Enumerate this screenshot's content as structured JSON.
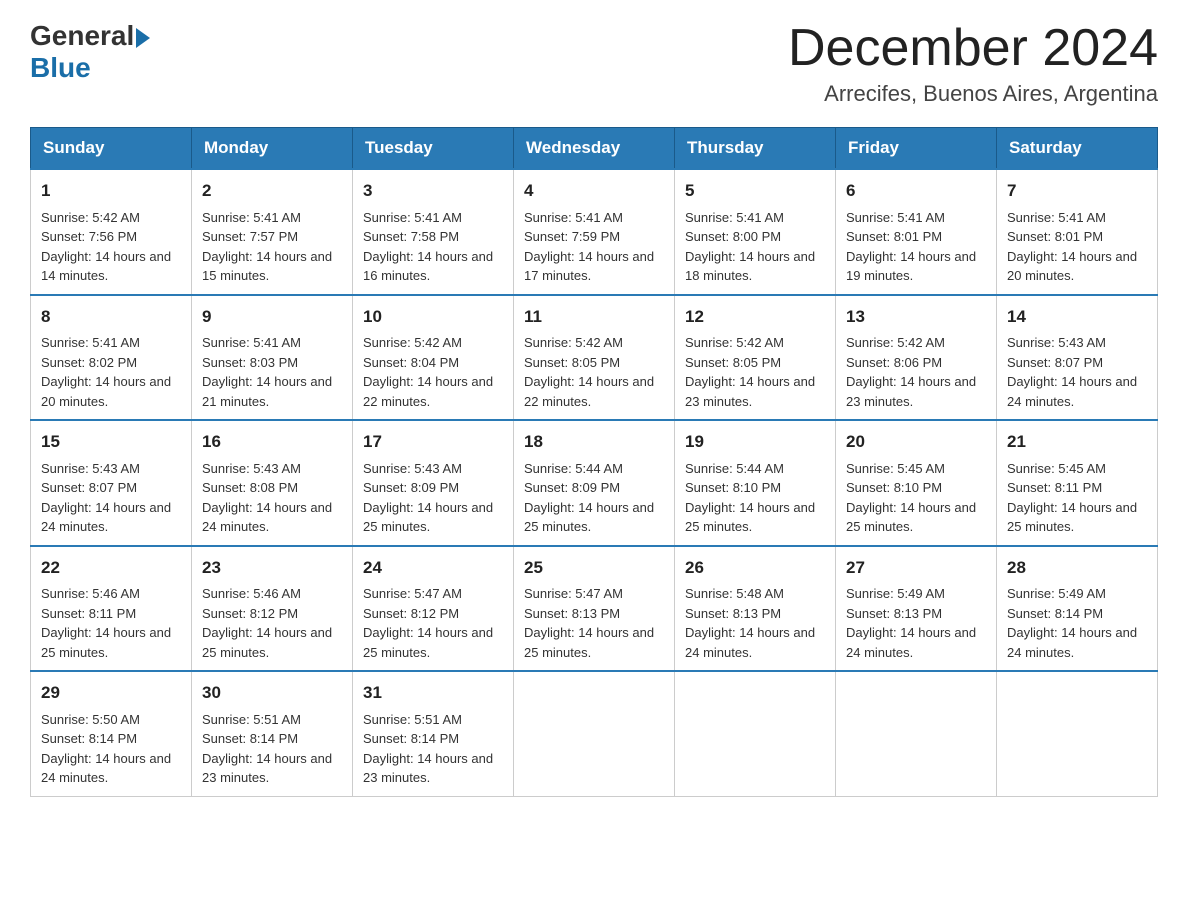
{
  "header": {
    "logo_general": "General",
    "logo_blue": "Blue",
    "month_title": "December 2024",
    "location": "Arrecifes, Buenos Aires, Argentina"
  },
  "days_of_week": [
    "Sunday",
    "Monday",
    "Tuesday",
    "Wednesday",
    "Thursday",
    "Friday",
    "Saturday"
  ],
  "weeks": [
    [
      {
        "day": "1",
        "sunrise": "Sunrise: 5:42 AM",
        "sunset": "Sunset: 7:56 PM",
        "daylight": "Daylight: 14 hours and 14 minutes."
      },
      {
        "day": "2",
        "sunrise": "Sunrise: 5:41 AM",
        "sunset": "Sunset: 7:57 PM",
        "daylight": "Daylight: 14 hours and 15 minutes."
      },
      {
        "day": "3",
        "sunrise": "Sunrise: 5:41 AM",
        "sunset": "Sunset: 7:58 PM",
        "daylight": "Daylight: 14 hours and 16 minutes."
      },
      {
        "day": "4",
        "sunrise": "Sunrise: 5:41 AM",
        "sunset": "Sunset: 7:59 PM",
        "daylight": "Daylight: 14 hours and 17 minutes."
      },
      {
        "day": "5",
        "sunrise": "Sunrise: 5:41 AM",
        "sunset": "Sunset: 8:00 PM",
        "daylight": "Daylight: 14 hours and 18 minutes."
      },
      {
        "day": "6",
        "sunrise": "Sunrise: 5:41 AM",
        "sunset": "Sunset: 8:01 PM",
        "daylight": "Daylight: 14 hours and 19 minutes."
      },
      {
        "day": "7",
        "sunrise": "Sunrise: 5:41 AM",
        "sunset": "Sunset: 8:01 PM",
        "daylight": "Daylight: 14 hours and 20 minutes."
      }
    ],
    [
      {
        "day": "8",
        "sunrise": "Sunrise: 5:41 AM",
        "sunset": "Sunset: 8:02 PM",
        "daylight": "Daylight: 14 hours and 20 minutes."
      },
      {
        "day": "9",
        "sunrise": "Sunrise: 5:41 AM",
        "sunset": "Sunset: 8:03 PM",
        "daylight": "Daylight: 14 hours and 21 minutes."
      },
      {
        "day": "10",
        "sunrise": "Sunrise: 5:42 AM",
        "sunset": "Sunset: 8:04 PM",
        "daylight": "Daylight: 14 hours and 22 minutes."
      },
      {
        "day": "11",
        "sunrise": "Sunrise: 5:42 AM",
        "sunset": "Sunset: 8:05 PM",
        "daylight": "Daylight: 14 hours and 22 minutes."
      },
      {
        "day": "12",
        "sunrise": "Sunrise: 5:42 AM",
        "sunset": "Sunset: 8:05 PM",
        "daylight": "Daylight: 14 hours and 23 minutes."
      },
      {
        "day": "13",
        "sunrise": "Sunrise: 5:42 AM",
        "sunset": "Sunset: 8:06 PM",
        "daylight": "Daylight: 14 hours and 23 minutes."
      },
      {
        "day": "14",
        "sunrise": "Sunrise: 5:43 AM",
        "sunset": "Sunset: 8:07 PM",
        "daylight": "Daylight: 14 hours and 24 minutes."
      }
    ],
    [
      {
        "day": "15",
        "sunrise": "Sunrise: 5:43 AM",
        "sunset": "Sunset: 8:07 PM",
        "daylight": "Daylight: 14 hours and 24 minutes."
      },
      {
        "day": "16",
        "sunrise": "Sunrise: 5:43 AM",
        "sunset": "Sunset: 8:08 PM",
        "daylight": "Daylight: 14 hours and 24 minutes."
      },
      {
        "day": "17",
        "sunrise": "Sunrise: 5:43 AM",
        "sunset": "Sunset: 8:09 PM",
        "daylight": "Daylight: 14 hours and 25 minutes."
      },
      {
        "day": "18",
        "sunrise": "Sunrise: 5:44 AM",
        "sunset": "Sunset: 8:09 PM",
        "daylight": "Daylight: 14 hours and 25 minutes."
      },
      {
        "day": "19",
        "sunrise": "Sunrise: 5:44 AM",
        "sunset": "Sunset: 8:10 PM",
        "daylight": "Daylight: 14 hours and 25 minutes."
      },
      {
        "day": "20",
        "sunrise": "Sunrise: 5:45 AM",
        "sunset": "Sunset: 8:10 PM",
        "daylight": "Daylight: 14 hours and 25 minutes."
      },
      {
        "day": "21",
        "sunrise": "Sunrise: 5:45 AM",
        "sunset": "Sunset: 8:11 PM",
        "daylight": "Daylight: 14 hours and 25 minutes."
      }
    ],
    [
      {
        "day": "22",
        "sunrise": "Sunrise: 5:46 AM",
        "sunset": "Sunset: 8:11 PM",
        "daylight": "Daylight: 14 hours and 25 minutes."
      },
      {
        "day": "23",
        "sunrise": "Sunrise: 5:46 AM",
        "sunset": "Sunset: 8:12 PM",
        "daylight": "Daylight: 14 hours and 25 minutes."
      },
      {
        "day": "24",
        "sunrise": "Sunrise: 5:47 AM",
        "sunset": "Sunset: 8:12 PM",
        "daylight": "Daylight: 14 hours and 25 minutes."
      },
      {
        "day": "25",
        "sunrise": "Sunrise: 5:47 AM",
        "sunset": "Sunset: 8:13 PM",
        "daylight": "Daylight: 14 hours and 25 minutes."
      },
      {
        "day": "26",
        "sunrise": "Sunrise: 5:48 AM",
        "sunset": "Sunset: 8:13 PM",
        "daylight": "Daylight: 14 hours and 24 minutes."
      },
      {
        "day": "27",
        "sunrise": "Sunrise: 5:49 AM",
        "sunset": "Sunset: 8:13 PM",
        "daylight": "Daylight: 14 hours and 24 minutes."
      },
      {
        "day": "28",
        "sunrise": "Sunrise: 5:49 AM",
        "sunset": "Sunset: 8:14 PM",
        "daylight": "Daylight: 14 hours and 24 minutes."
      }
    ],
    [
      {
        "day": "29",
        "sunrise": "Sunrise: 5:50 AM",
        "sunset": "Sunset: 8:14 PM",
        "daylight": "Daylight: 14 hours and 24 minutes."
      },
      {
        "day": "30",
        "sunrise": "Sunrise: 5:51 AM",
        "sunset": "Sunset: 8:14 PM",
        "daylight": "Daylight: 14 hours and 23 minutes."
      },
      {
        "day": "31",
        "sunrise": "Sunrise: 5:51 AM",
        "sunset": "Sunset: 8:14 PM",
        "daylight": "Daylight: 14 hours and 23 minutes."
      },
      null,
      null,
      null,
      null
    ]
  ]
}
